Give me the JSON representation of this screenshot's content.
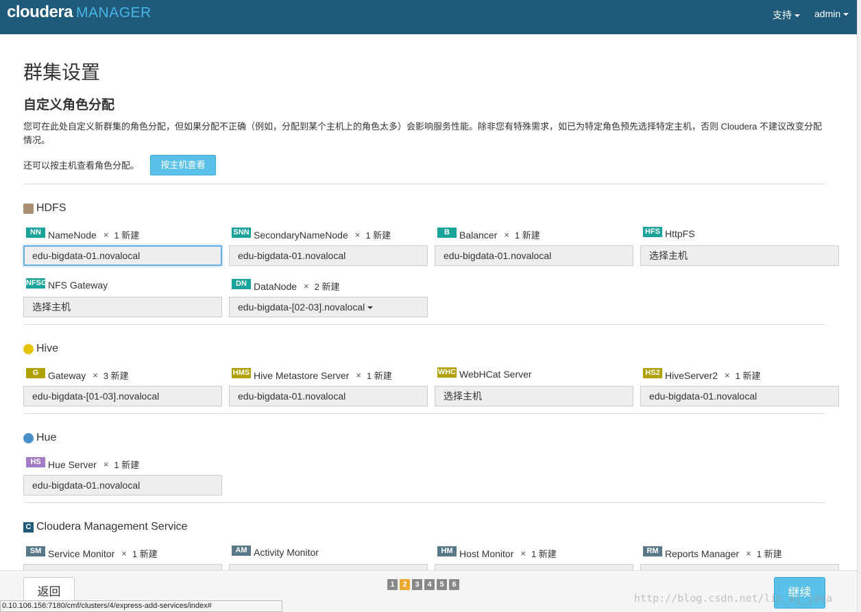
{
  "header": {
    "brand": "cloudera",
    "brand_suffix": "MANAGER",
    "support_label": "支持",
    "user_label": "admin"
  },
  "page": {
    "title": "群集设置",
    "subtitle": "自定义角色分配",
    "description": "您可在此处自定义新群集的角色分配，但如果分配不正确（例如，分配到某个主机上的角色太多）会影响服务性能。除非您有特殊需求，如已为特定角色预先选择特定主机，否则 Cloudera 不建议改变分配情况。",
    "hostview_text": "还可以按主机查看角色分配。",
    "hostview_button": "按主机查看"
  },
  "sections": [
    {
      "name": "HDFS",
      "roles": [
        {
          "badge": "NN",
          "badge_color": "#1aa39a",
          "label": "NameNode",
          "times": "×",
          "count": "1 新建",
          "host": "edu-bigdata-01.novalocal"
        },
        {
          "badge": "SNN",
          "badge_color": "#1aa39a",
          "label": "SecondaryNameNode",
          "times": "×",
          "count": "1 新建",
          "host": "edu-bigdata-01.novalocal"
        },
        {
          "badge": "B",
          "badge_color": "#1aa39a",
          "label": "Balancer",
          "times": "×",
          "count": "1 新建",
          "host": "edu-bigdata-01.novalocal"
        },
        {
          "badge": "HFS",
          "badge_color": "#1aa39a",
          "label": "HttpFS",
          "host": "选择主机"
        },
        {
          "badge": "NFSG",
          "badge_color": "#1aa39a",
          "label": "NFS Gateway",
          "host": "选择主机"
        },
        {
          "badge": "DN",
          "badge_color": "#1aa39a",
          "label": "DataNode",
          "times": "×",
          "count": "2 新建",
          "host": "edu-bigdata-[02-03].novalocal"
        }
      ]
    },
    {
      "name": "Hive",
      "roles": [
        {
          "badge": "G",
          "badge_color": "#b0a000",
          "label": "Gateway",
          "times": "×",
          "count": "3 新建",
          "host": "edu-bigdata-[01-03].novalocal"
        },
        {
          "badge": "HMS",
          "badge_color": "#b0a000",
          "label": "Hive Metastore Server",
          "times": "×",
          "count": "1 新建",
          "host": "edu-bigdata-01.novalocal"
        },
        {
          "badge": "WHC",
          "badge_color": "#b0a000",
          "label": "WebHCat Server",
          "host": "选择主机"
        },
        {
          "badge": "HS2",
          "badge_color": "#b0a000",
          "label": "HiveServer2",
          "times": "×",
          "count": "1 新建",
          "host": "edu-bigdata-01.novalocal"
        }
      ]
    },
    {
      "name": "Hue",
      "roles": [
        {
          "badge": "HS",
          "badge_color": "#a57cc7",
          "label": "Hue Server",
          "times": "×",
          "count": "1 新建",
          "host": "edu-bigdata-01.novalocal"
        }
      ]
    },
    {
      "name": "Cloudera Management Service",
      "roles": [
        {
          "badge": "SM",
          "badge_color": "#5a7a8a",
          "label": "Service Monitor",
          "times": "×",
          "count": "1 新建"
        },
        {
          "badge": "AM",
          "badge_color": "#5a7a8a",
          "label": "Activity Monitor"
        },
        {
          "badge": "HM",
          "badge_color": "#5a7a8a",
          "label": "Host Monitor",
          "times": "×",
          "count": "1 新建"
        },
        {
          "badge": "RM",
          "badge_color": "#5a7a8a",
          "label": "Reports Manager",
          "times": "×",
          "count": "1 新建"
        }
      ]
    }
  ],
  "footer": {
    "back": "返回",
    "next": "继续",
    "pages": [
      "1",
      "2",
      "3",
      "4",
      "5",
      "6"
    ],
    "current_page": "2",
    "status_url": "0.10.106.156:7180/cmf/clusters/4/express-add-services/index#",
    "watermark": "http://blog.csdn.net/lin_wj_java"
  }
}
